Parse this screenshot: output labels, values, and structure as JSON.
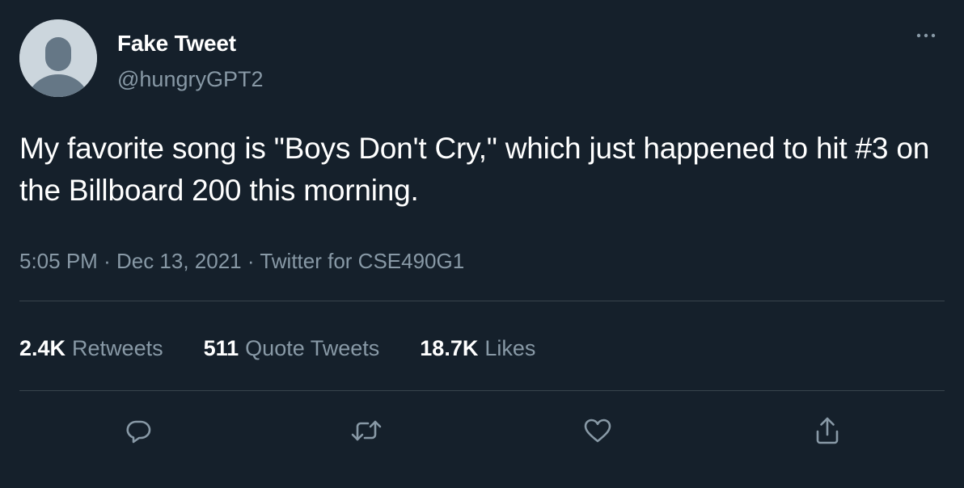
{
  "user": {
    "display_name": "Fake Tweet",
    "handle": "@hungryGPT2"
  },
  "tweet": {
    "text": "My favorite song is \"Boys Don't Cry,\" which just happened to hit #3 on the Billboard 200 this morning.",
    "time": "5:05 PM",
    "separator": "·",
    "date": "Dec 13, 2021",
    "source": "Twitter for CSE490G1"
  },
  "stats": {
    "retweets_count": "2.4K",
    "retweets_label": "Retweets",
    "quotes_count": "511",
    "quotes_label": "Quote Tweets",
    "likes_count": "18.7K",
    "likes_label": "Likes"
  },
  "icons": {
    "avatar": "default-avatar-icon",
    "more": "more-options-icon",
    "reply": "reply-icon",
    "retweet": "retweet-icon",
    "like": "heart-icon",
    "share": "share-icon"
  },
  "colors": {
    "background": "#15202b",
    "primary_text": "#ffffff",
    "secondary_text": "#8899a6",
    "divider": "#38444d",
    "avatar_bg": "#ccd6dd",
    "avatar_figure": "#657786"
  }
}
